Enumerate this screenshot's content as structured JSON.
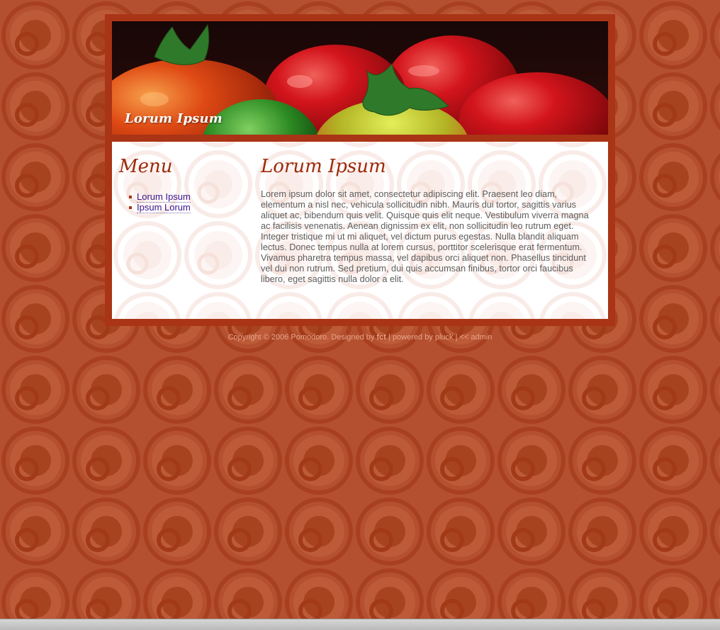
{
  "header": {
    "title": "Lorum Ipsum"
  },
  "sidebar": {
    "heading": "Menu",
    "items": [
      {
        "label": "Lorum Ipsum"
      },
      {
        "label": "Ipsum Lorum"
      }
    ]
  },
  "main": {
    "heading": "Lorum Ipsum",
    "body": "Lorem ipsum dolor sit amet, consectetur adipiscing elit. Praesent leo diam, elementum a nisl nec, vehicula sollicitudin nibh. Mauris dui tortor, sagittis varius aliquet ac, bibendum quis velit. Quisque quis elit neque. Vestibulum viverra magna ac facilisis venenatis. Aenean dignissim ex elit, non sollicitudin leo rutrum eget. Integer tristique mi ut mi aliquet, vel dictum purus egestas. Nulla blandit aliquam lectus. Donec tempus nulla at lorem cursus, porttitor scelerisque erat fermentum. Vivamus pharetra tempus massa, vel dapibus orci aliquet non. Phasellus tincidunt vel dui non rutrum. Sed pretium, dui quis accumsan finibus, tortor orci faucibus libero, eget sagittis nulla dolor a elit."
  },
  "footer": {
    "copyright": "Copyright © 2006 Pomodoro. Designed by ",
    "designer": "fct",
    "sep1": " | ",
    "powered": "powered by pluck",
    "sep2": " | ",
    "admin": "<< admin"
  },
  "colors": {
    "background": "#b4502f",
    "frame": "#a93416",
    "heading": "#9c2a0b",
    "link": "#3a1390",
    "body_text": "#5d5d5d",
    "footer_text": "#e6a58c"
  },
  "icons": {
    "menu_bullet": "square-bullet-icon",
    "header_image": "tomatoes-photo"
  }
}
